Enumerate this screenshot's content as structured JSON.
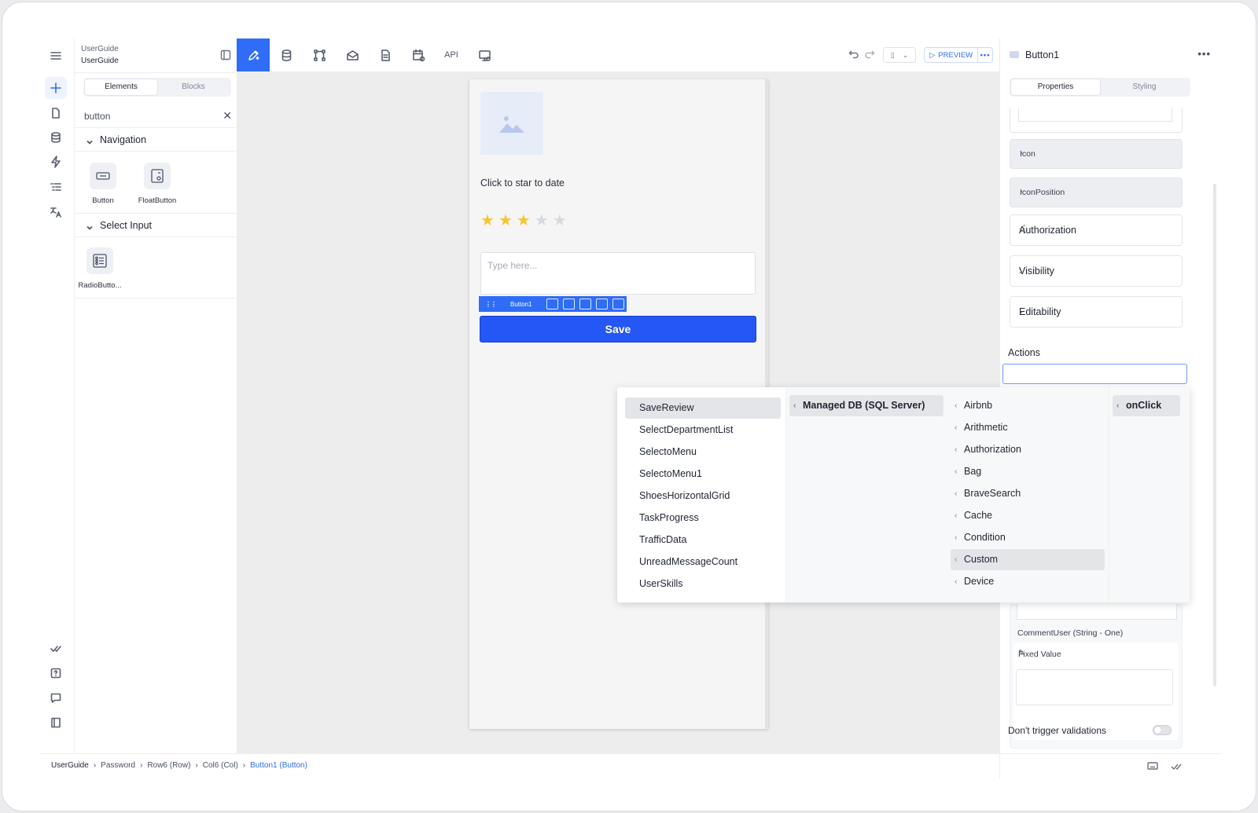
{
  "panel": {
    "project": "UserGuide",
    "page": "UserGuide",
    "tabs": [
      "Elements",
      "Blocks"
    ],
    "search_value": "button",
    "groups": [
      {
        "title": "Navigation",
        "items": [
          "Button",
          "FloatButton"
        ]
      },
      {
        "title": "Select Input",
        "items": [
          "RadioButto..."
        ]
      }
    ]
  },
  "toolbar": {
    "api_label": "API",
    "preview_label": "PREVIEW",
    "more": "•••"
  },
  "canvas": {
    "caption": "Click to star to date",
    "rating": {
      "value": 3,
      "max": 5,
      "filled_color": "#f6c531",
      "empty_color": "#d8d9dd"
    },
    "textarea_placeholder": "Type here...",
    "selected_component": "Button1",
    "save_label": "Save"
  },
  "props": {
    "title": "Button1",
    "more": "•••",
    "tabs": [
      "Properties",
      "Styling"
    ],
    "gray_rows": [
      "Icon",
      "IconPosition"
    ],
    "rows": [
      "Authorization",
      "Visibility",
      "Editability"
    ],
    "actions_label": "Actions",
    "param_label": "CommentUser (String - One)",
    "fixed_value_label": "Fixed Value",
    "dont_trigger_label": "Don't trigger validations"
  },
  "dropdown": {
    "col1": [
      "SaveReview",
      "SelectDepartmentList",
      "SelectoMenu",
      "SelectoMenu1",
      "ShoesHorizontalGrid",
      "TaskProgress",
      "TrafficData",
      "UnreadMessageCount",
      "UserSkills"
    ],
    "col2": [
      "Managed DB (SQL Server)"
    ],
    "col3": [
      "Airbnb",
      "Arithmetic",
      "Authorization",
      "Bag",
      "BraveSearch",
      "Cache",
      "Condition",
      "Custom",
      "Device"
    ],
    "col4": [
      "onClick"
    ]
  },
  "breadcrumb": [
    "UserGuide",
    "Password",
    "Row6 (Row)",
    "Col6 (Col)",
    "Button1 (Button)"
  ],
  "colors": {
    "accent": "#2f6df6",
    "save_button": "#2457f5"
  }
}
